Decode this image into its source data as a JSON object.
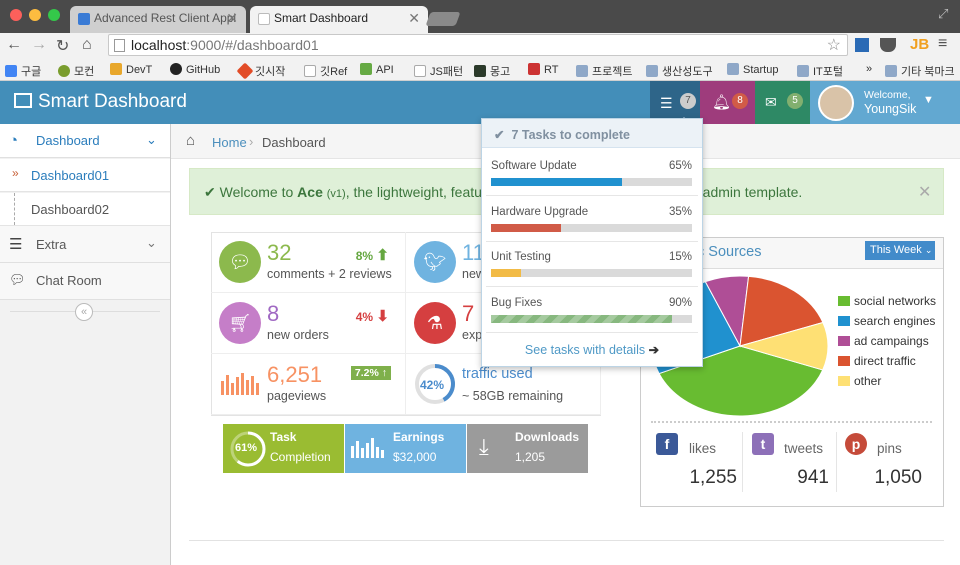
{
  "browser": {
    "tabs": [
      {
        "label": "Advanced Rest Client Appl"
      },
      {
        "label": "Smart Dashboard"
      }
    ],
    "url_host": "localhost",
    "url_path": ":9000/#/dashboard01",
    "bookmarks": [
      "구글",
      "모컨",
      "DevT",
      "GitHub",
      "깃시작",
      "깃Ref",
      "API",
      "JS패턴",
      "몽고",
      "RT",
      "프로젝트",
      "생산성도구",
      "Startup",
      "IT포털",
      "»",
      "기타 북마크"
    ]
  },
  "navbar": {
    "brand": "Smart Dashboard",
    "tasks_count": "7",
    "notifications_count": "8",
    "messages_count": "5",
    "welcome": "Welcome,",
    "user": "YoungSik",
    "colors": {
      "navbar": "#438eb9",
      "tasks": "#2e6589",
      "notifications": "#9e3c7c",
      "messages": "#2e8965",
      "user": "#62a8d1"
    }
  },
  "sidebar": {
    "dashboard": "Dashboard",
    "dashboard01": "Dashboard01",
    "dashboard02": "Dashboard02",
    "extra": "Extra",
    "chat": "Chat Room"
  },
  "breadcrumb": {
    "home": "Home",
    "current": "Dashboard"
  },
  "alert": {
    "pre": "Welcome to ",
    "name": "Ace",
    "version": "(v1)",
    "mid": ", the lightweight, feature-",
    "post": "d admin template."
  },
  "infoboxes": [
    {
      "num": "32",
      "sub": "comments + 2 reviews",
      "stat": "8%",
      "stat_dir": "up",
      "icon": "comments-icon",
      "color": "#8cb94d"
    },
    {
      "num": "11",
      "sub": "new",
      "icon": "twitter-icon",
      "color": "#6fb3e0"
    },
    {
      "num": "8",
      "sub": "new orders",
      "stat": "4%",
      "stat_dir": "down",
      "icon": "shopping-cart-icon",
      "color": "#c57ec8"
    },
    {
      "num": "7",
      "sub": "exp",
      "icon": "flask-icon",
      "color": "#d53f40"
    },
    {
      "num": "6,251",
      "sub": "pageviews",
      "stat": "7.2%",
      "icon": "bar-chart-icon",
      "color": "#f79263"
    },
    {
      "num": "42%",
      "sub": "~ 58GB remaining",
      "title": "traffic used",
      "ring_value": 42,
      "color": "#4b8ccc"
    }
  ],
  "tiles": [
    {
      "title": "Task",
      "sub": "Completion",
      "ring": "61%",
      "ring_value": 61,
      "color": "#9abc32"
    },
    {
      "title": "Earnings",
      "sub": "$32,000",
      "color": "#6fb3e0"
    },
    {
      "title": "Downloads",
      "sub": "1,205",
      "color": "#9b9b9b"
    }
  ],
  "widget": {
    "title_visible": "c Sources",
    "range": "This Week",
    "legend": [
      {
        "label": "social networks",
        "color": "#68bc31"
      },
      {
        "label": "search engines",
        "color": "#2091cf"
      },
      {
        "label": "ad campaings",
        "color": "#af4e96"
      },
      {
        "label": "direct traffic",
        "color": "#da5430"
      },
      {
        "label": "other",
        "color": "#fee074"
      }
    ],
    "social": [
      {
        "label": "likes",
        "num": "1,255",
        "icon": "facebook-icon",
        "color": "#3b5998"
      },
      {
        "label": "tweets",
        "num": "941",
        "icon": "twitter-icon",
        "color": "#8d70b8"
      },
      {
        "label": "pins",
        "num": "1,050",
        "icon": "pinterest-icon",
        "color": "#c54b3a"
      }
    ]
  },
  "chart_data": {
    "type": "pie",
    "categories": [
      "social networks",
      "search engines",
      "ad campaings",
      "direct traffic",
      "other"
    ],
    "values": [
      38,
      25,
      8,
      18,
      11
    ]
  },
  "tasks": {
    "title": "7 Tasks to complete",
    "items": [
      {
        "name": "Software Update",
        "percent": "65%",
        "value": 65,
        "color": "#2091cf"
      },
      {
        "name": "Hardware Upgrade",
        "percent": "35%",
        "value": 35,
        "color": "#d15b47"
      },
      {
        "name": "Unit Testing",
        "percent": "15%",
        "value": 15,
        "color": "#f2bb46"
      },
      {
        "name": "Bug Fixes",
        "percent": "90%",
        "value": 90,
        "color": "#87b87f"
      }
    ],
    "footer": "See tasks with details"
  }
}
